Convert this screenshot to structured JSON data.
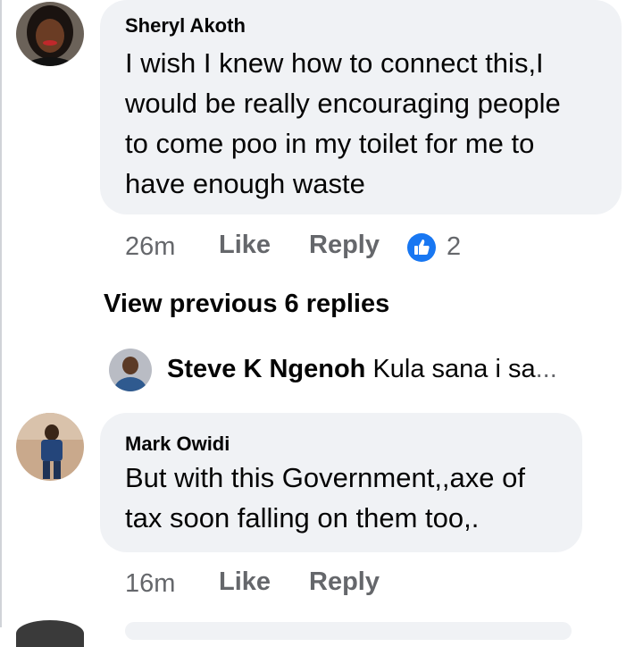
{
  "comments": [
    {
      "author": "Sheryl Akoth",
      "text_lines": [
        "I wish I knew how to connect this,I",
        "would be really encouraging people",
        "to come poo in my toilet for me to",
        "have enough waste"
      ],
      "time": "26m",
      "like_label": "Like",
      "reply_label": "Reply",
      "reaction_count": "2",
      "reaction_icon": "thumbs-up-icon"
    },
    {
      "author": "Mark Owidi",
      "text_lines": [
        "But with this Government,,axe of",
        "tax soon falling on them too,."
      ],
      "time": "16m",
      "like_label": "Like",
      "reply_label": "Reply"
    }
  ],
  "view_previous": "View previous 6 replies",
  "reply_preview": {
    "author": "Steve K Ngenoh",
    "text": "Kula sana i sa",
    "ellipsis": "..."
  },
  "colors": {
    "bubble": "#f0f2f5",
    "meta": "#65676b",
    "reaction_blue": "#1877f2"
  }
}
